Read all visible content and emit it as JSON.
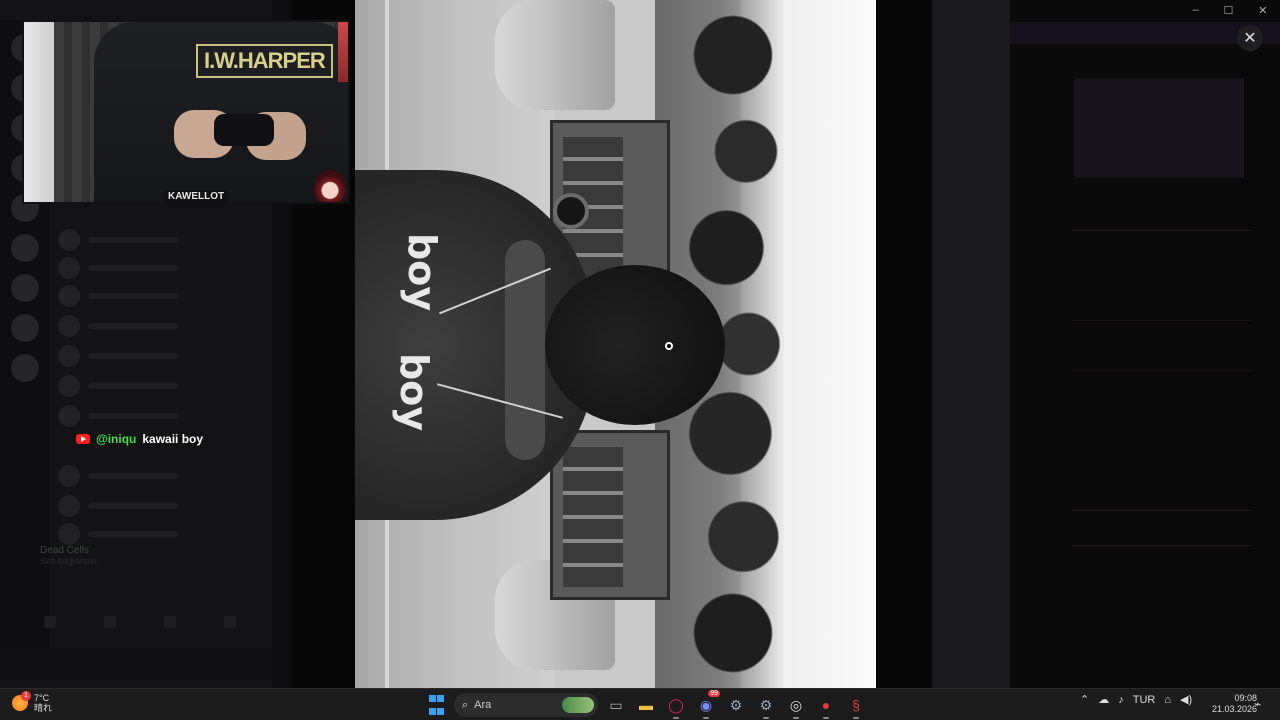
{
  "webcam": {
    "shirt_print": "I.W.HARPER",
    "name_tag": "KAWELLOT"
  },
  "chat": {
    "username": "@iniqu",
    "message": "kawaii boy"
  },
  "discord_bg": {
    "voice_channel": "Dead Cells",
    "voice_sub": "Ses bağlantısı"
  },
  "video": {
    "print_a": "boy",
    "print_b": "boy"
  },
  "viewer": {
    "close_icon": "close-icon"
  },
  "taskbar": {
    "weather": {
      "temp": "7°C",
      "condition": "晴れ",
      "badge": "1"
    },
    "search_placeholder": "Ara",
    "discord_badge": "99",
    "language": "TUR",
    "time": "09:08",
    "date": "21.03.2026"
  },
  "colors": {
    "chat_user": "#4ade4a",
    "accent": "#3aa0f0"
  }
}
